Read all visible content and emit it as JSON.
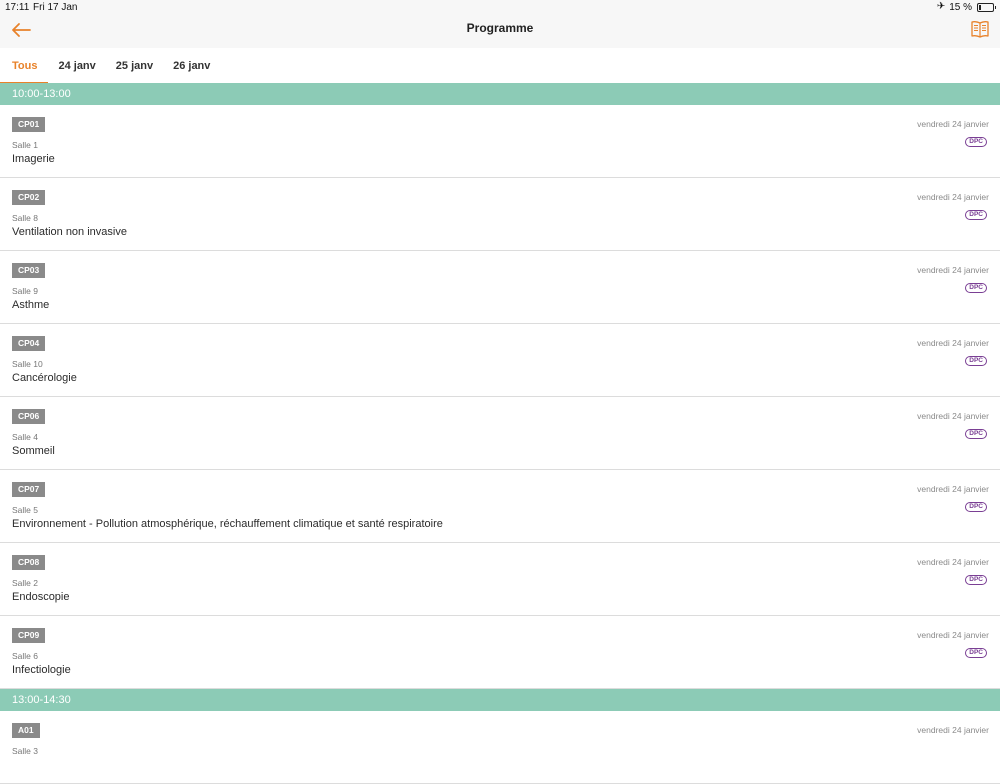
{
  "status_bar": {
    "time": "17:11",
    "date": "Fri 17 Jan",
    "battery_text": "15 %",
    "battery_level": 0.15
  },
  "nav": {
    "title": "Programme",
    "back_icon": "back-arrow-icon",
    "book_icon": "book-icon"
  },
  "colors": {
    "accent": "#e8822a",
    "section_header": "#8ccbb6",
    "badge": "#8a8a8a",
    "dpc": "#7a3f94"
  },
  "tabs": [
    {
      "label": "Tous",
      "active": true
    },
    {
      "label": "24 janv",
      "active": false
    },
    {
      "label": "25 janv",
      "active": false
    },
    {
      "label": "26 janv",
      "active": false
    }
  ],
  "sections": [
    {
      "time": "10:00-13:00",
      "sessions": [
        {
          "code": "CP01",
          "room": "Salle 1",
          "title": "Imagerie",
          "date": "vendredi 24 janvier",
          "badge": "DPC"
        },
        {
          "code": "CP02",
          "room": "Salle 8",
          "title": "Ventilation non invasive",
          "date": "vendredi 24 janvier",
          "badge": "DPC"
        },
        {
          "code": "CP03",
          "room": "Salle 9",
          "title": "Asthme",
          "date": "vendredi 24 janvier",
          "badge": "DPC"
        },
        {
          "code": "CP04",
          "room": "Salle 10",
          "title": "Cancérologie",
          "date": "vendredi 24 janvier",
          "badge": "DPC"
        },
        {
          "code": "CP06",
          "room": "Salle 4",
          "title": "Sommeil",
          "date": "vendredi 24 janvier",
          "badge": "DPC"
        },
        {
          "code": "CP07",
          "room": "Salle 5",
          "title": "Environnement - Pollution atmosphérique, réchauffement climatique et santé respiratoire",
          "date": "vendredi 24 janvier",
          "badge": "DPC"
        },
        {
          "code": "CP08",
          "room": "Salle 2",
          "title": "Endoscopie",
          "date": "vendredi 24 janvier",
          "badge": "DPC"
        },
        {
          "code": "CP09",
          "room": "Salle 6",
          "title": "Infectiologie",
          "date": "vendredi 24 janvier",
          "badge": "DPC"
        }
      ]
    },
    {
      "time": "13:00-14:30",
      "sessions": [
        {
          "code": "A01",
          "room": "Salle 3",
          "title": "",
          "date": "vendredi 24 janvier",
          "badge": ""
        }
      ]
    }
  ]
}
